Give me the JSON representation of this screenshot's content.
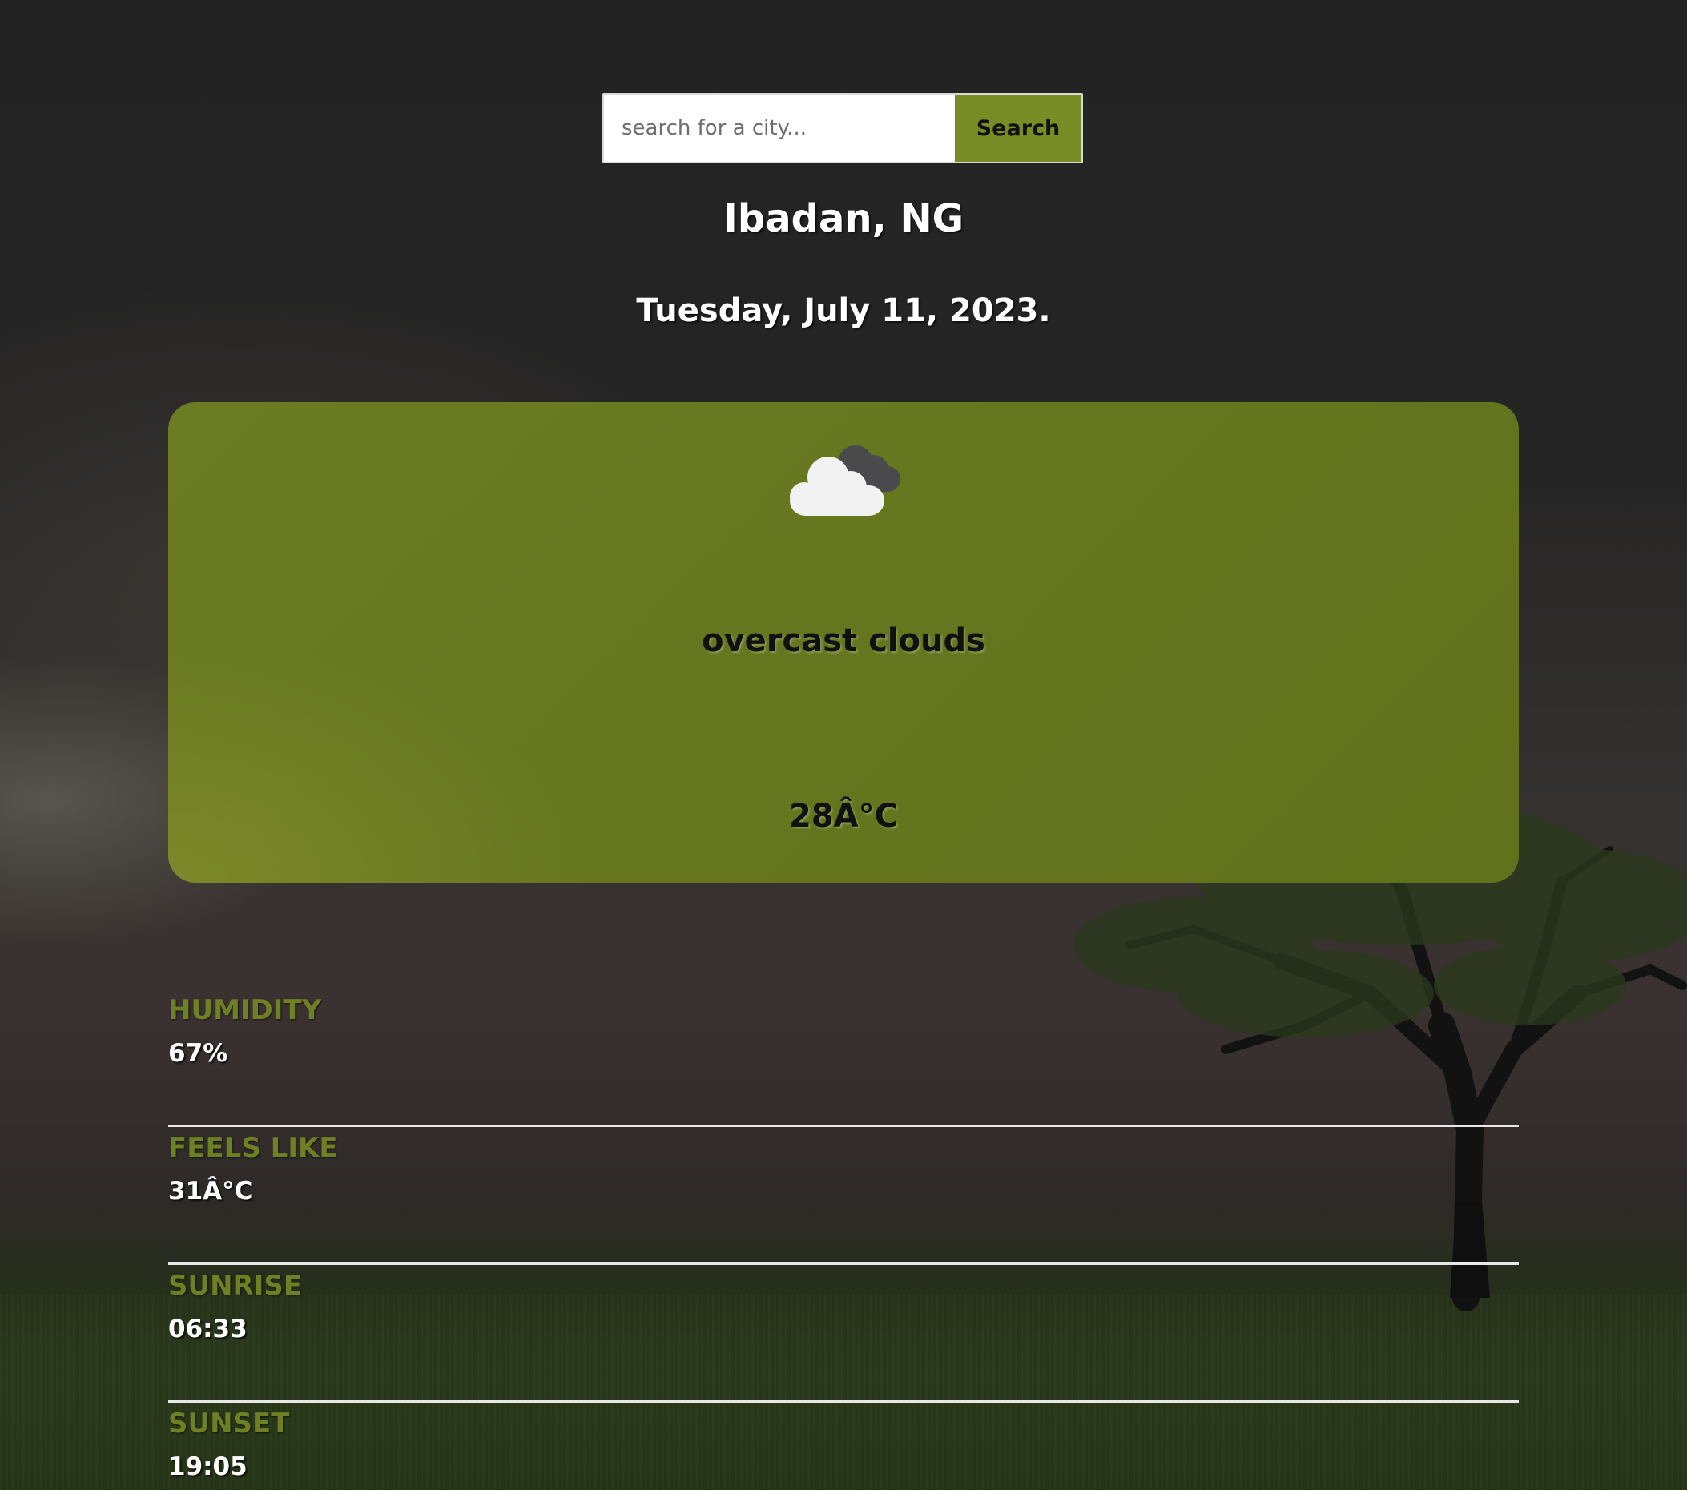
{
  "search": {
    "placeholder": "search for a city...",
    "button_label": "Search"
  },
  "location": {
    "city": "Ibadan, NG",
    "date": "Tuesday, July 11, 2023."
  },
  "weather": {
    "icon": "overcast-clouds-icon",
    "description": "overcast clouds",
    "temperature": "28Â°C"
  },
  "details": [
    {
      "label": "HUMIDITY",
      "value": "67%"
    },
    {
      "label": "FEELS LIKE",
      "value": "31Â°C"
    },
    {
      "label": "SUNRISE",
      "value": "06:33"
    },
    {
      "label": "SUNSET",
      "value": "19:05"
    }
  ],
  "colors": {
    "accent": "#7a8c26",
    "card": "#67771f",
    "label": "#6f7f24"
  }
}
